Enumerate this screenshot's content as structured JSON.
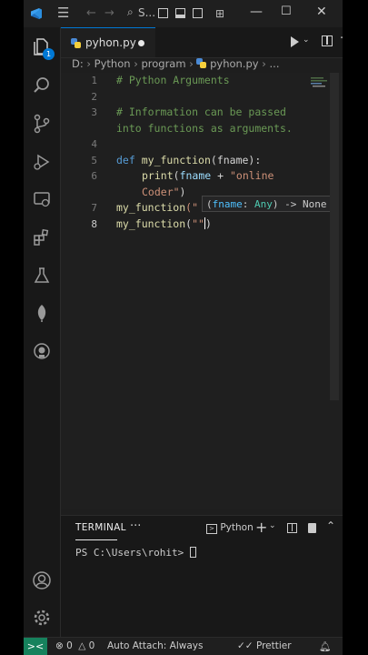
{
  "titlebar": {
    "search_label": "S..."
  },
  "tab": {
    "filename": "pyhon.py"
  },
  "breadcrumb": {
    "drive": "D:",
    "items": [
      "Python",
      "program",
      "pyhon.py",
      "..."
    ]
  },
  "editor": {
    "line_numbers": [
      "1",
      "2",
      "3",
      "4",
      "5",
      "6",
      "7",
      "8"
    ],
    "lines": {
      "l1": "# Python Arguments",
      "l3a": "# Information can be passed",
      "l3b": "into functions as arguments.",
      "l5_def": "def",
      "l5_fn": "my_function",
      "l5_rest": "(fname):",
      "l6_fn": "print",
      "l6_open": "(",
      "l6_var": "fname",
      "l6_plus": " + ",
      "l6_str": "\"online",
      "l6b_str": "Coder\"",
      "l6b_close": ")",
      "l7_fn": "my_function",
      "l7_rest": "(\"",
      "l8_fn": "my_function",
      "l8_open": "(",
      "l8_str": "\"\"",
      "l8_close": ")"
    },
    "hint": {
      "open": "(",
      "param": "fname",
      "colon": ": ",
      "type": "Any",
      "close": ")",
      "ret": " -> None"
    }
  },
  "panel": {
    "tab_label": "TERMINAL",
    "more": "···",
    "shell_label": "Python",
    "terminal_prompt": "PS C:\\Users\\rohit> "
  },
  "status": {
    "remote": "><",
    "errors": "0",
    "warnings": "0",
    "auto_attach": "Auto Attach: Always",
    "prettier": "Prettier"
  },
  "icons": {
    "vscode": "vscode-logo-icon",
    "explorer": "files-icon",
    "search": "search-icon",
    "scm": "source-control-icon",
    "run": "run-debug-icon",
    "remote": "remote-explorer-icon",
    "extensions": "extensions-icon",
    "testing": "flask-icon",
    "mongodb": "leaf-icon",
    "github": "github-icon",
    "accounts": "account-icon",
    "settings": "gear-icon"
  },
  "badges": {
    "explorer_badge": "1"
  },
  "colors": {
    "accent": "#0078d4",
    "remote": "#16825d",
    "comment": "#6a9955",
    "keyword": "#569cd6",
    "function": "#dcdcaa",
    "string": "#ce9178"
  }
}
